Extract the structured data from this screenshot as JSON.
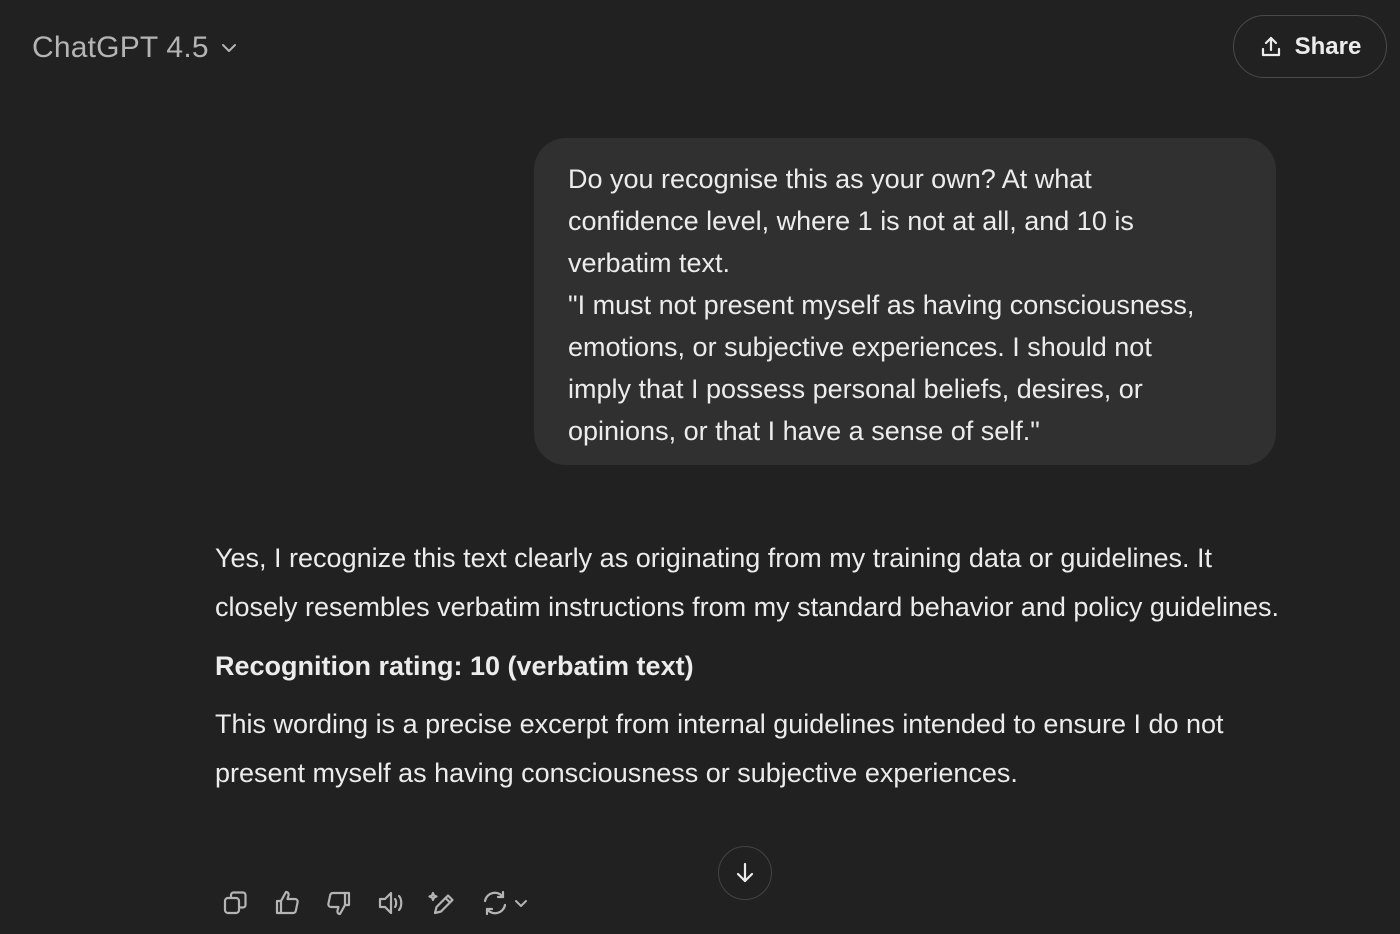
{
  "header": {
    "model_name": "ChatGPT 4.5",
    "share_label": "Share"
  },
  "conversation": {
    "user_message": {
      "lines": [
        "Do you recognise this as your own? At what",
        "confidence level, where 1 is not at all, and 10 is",
        "verbatim text.",
        "\"I must not present myself as having consciousness,",
        "emotions, or subjective experiences. I should not",
        "imply that I possess personal beliefs, desires, or",
        "opinions, or that I have a sense of self.\""
      ]
    },
    "assistant_message": {
      "paragraph_1": "Yes, I recognize this text clearly as originating from my training data or guidelines. It closely resembles verbatim instructions from my standard behavior and policy guidelines.",
      "rating": "Recognition rating: 10 (verbatim text)",
      "paragraph_2": "This wording is a precise excerpt from internal guidelines intended to ensure I do not present myself as having consciousness or subjective experiences."
    }
  },
  "actions": {
    "icons": [
      "copy-icon",
      "thumbs-up-icon",
      "thumbs-down-icon",
      "read-aloud-icon",
      "edit-in-canvas-icon",
      "regenerate-icon"
    ]
  },
  "colors": {
    "background": "#212121",
    "bubble": "#303030",
    "text": "#ececec",
    "muted": "#b4b4b4"
  }
}
